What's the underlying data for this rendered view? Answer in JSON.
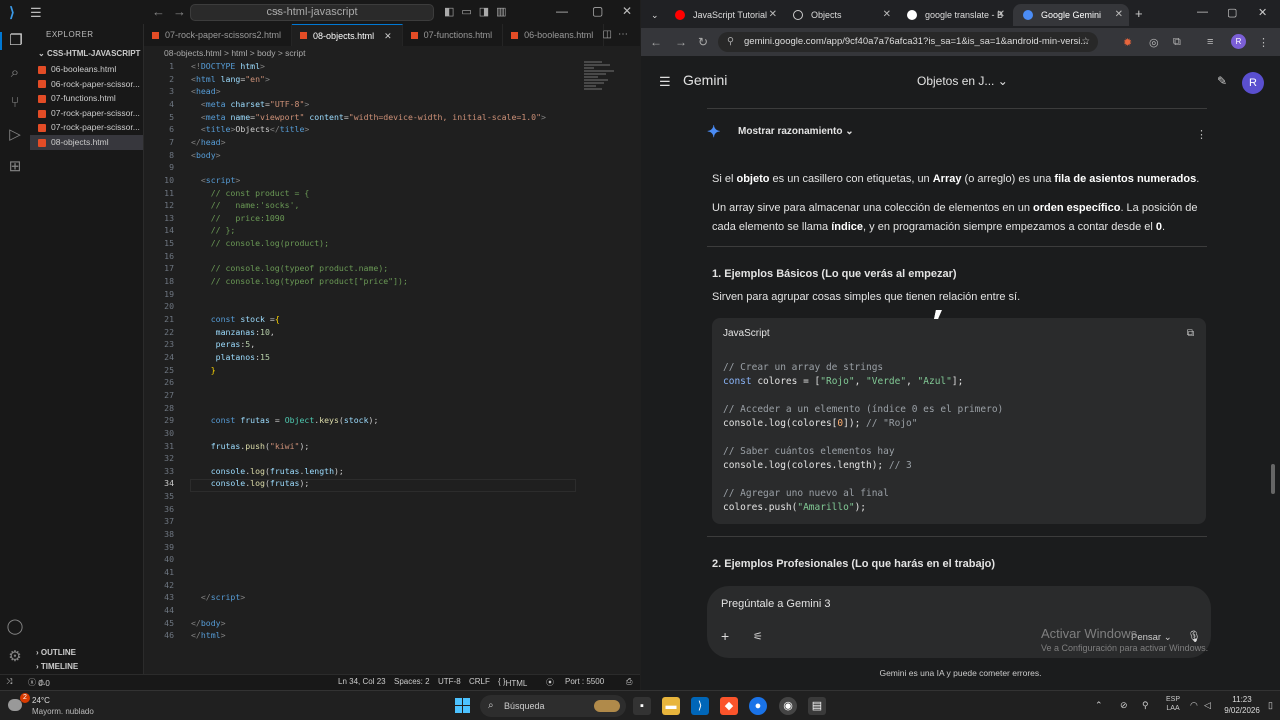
{
  "vscode": {
    "search_text": "css-html-javascript",
    "explorer_title": "EXPLORER",
    "project": "CSS-HTML-JAVASCRIPT",
    "files": [
      "06-booleans.html",
      "06-rock-paper-scissor...",
      "07-functions.html",
      "07-rock-paper-scissor...",
      "07-rock-paper-scissor...",
      "08-objects.html"
    ],
    "outline": "OUTLINE",
    "timeline": "TIMELINE",
    "tabs": [
      {
        "label": "07-rock-paper-scissors2.html"
      },
      {
        "label": "08-objects.html"
      },
      {
        "label": "07-functions.html"
      },
      {
        "label": "06-booleans.html"
      }
    ],
    "breadcrumb": "08-objects.html > html > body > script",
    "line_numbers": [
      "1",
      "2",
      "3",
      "4",
      "5",
      "6",
      "7",
      "8",
      "9",
      "10",
      "11",
      "12",
      "13",
      "14",
      "15",
      "16",
      "17",
      "18",
      "19",
      "20",
      "21",
      "22",
      "23",
      "24",
      "25",
      "26",
      "27",
      "28",
      "29",
      "30",
      "31",
      "32",
      "33",
      "34",
      "35",
      "36",
      "37",
      "38",
      "39",
      "40",
      "41",
      "42",
      "43",
      "44",
      "45",
      "46"
    ],
    "status": {
      "errors": "0",
      "warnings": "0",
      "position": "Ln 34, Col 23",
      "spaces": "Spaces: 2",
      "encoding": "UTF-8",
      "eol": "CRLF",
      "lang": "HTML",
      "port": "Port : 5500"
    }
  },
  "chrome": {
    "tabs": [
      {
        "label": "JavaScript Tutorial",
        "color": "#ff0000"
      },
      {
        "label": "Objects",
        "color": "#cccccc"
      },
      {
        "label": "google translate - B",
        "color": "#4285f4"
      },
      {
        "label": "Google Gemini",
        "color": "#4b8cf5"
      }
    ],
    "url": "gemini.google.com/app/9cf40a7a76afca31?is_sa=1&is_sa=1&android-min-versi...",
    "profile": "R"
  },
  "gemini": {
    "title": "Gemini",
    "chat_title": "Objetos en J...",
    "avatar": "R",
    "reasoning": "Mostrar razonamiento",
    "p1": {
      "a": "Si el ",
      "b": "objeto",
      "c": " es un casillero con etiquetas, un ",
      "d": "Array",
      "e": " (o arreglo) es una ",
      "f": "fila de asientos numerados",
      "g": "."
    },
    "p2": {
      "a": "Un array sirve para almacenar una colección de elementos en un ",
      "b": "orden específico",
      "c": ". La posición de",
      "d": "cada elemento se llama ",
      "e": "índice",
      "f": ", y en programación siempre empezamos a contar desde el ",
      "g": "0",
      "h": "."
    },
    "h1": "1. Ejemplos Básicos (Lo que verás al empezar)",
    "p3": "Sirven para agrupar cosas simples que tienen relación entre sí.",
    "code_lang": "JavaScript",
    "h2": "2. Ejemplos Profesionales (Lo que harás en el trabajo)",
    "input_placeholder": "Pregúntale a Gemini 3",
    "mode": "Pensar",
    "disclaimer": "Gemini es una IA y puede cometer errores.",
    "activate_title": "Activar Windows",
    "activate_sub": "Ve a Configuración para activar Windows."
  },
  "taskbar": {
    "temp": "24°C",
    "weather": "Mayorm. nublado",
    "badge": "2",
    "search": "Búsqueda",
    "lang1": "ESP",
    "lang2": "LAA",
    "time": "11:23",
    "date": "9/02/2026"
  }
}
